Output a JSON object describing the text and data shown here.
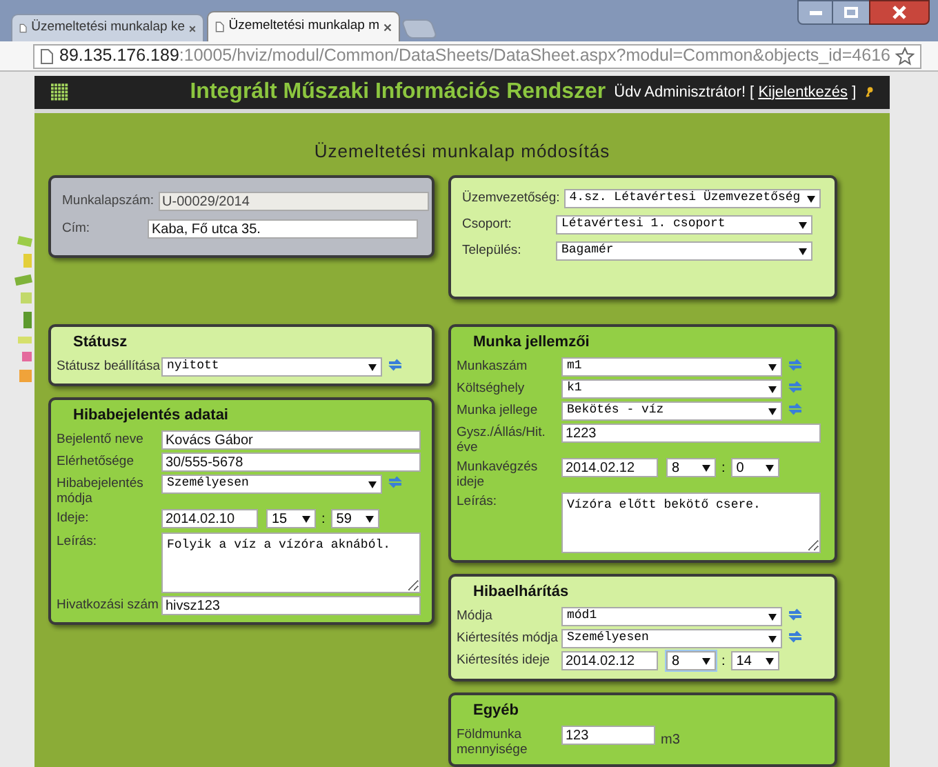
{
  "browser": {
    "tabs": [
      {
        "title": "Üzemeltetési munkalap ke",
        "selected": false
      },
      {
        "title": "Üzemeltetési munkalap m",
        "selected": true
      }
    ],
    "url_host": "89.135.176.189",
    "url_rest": ":10005/hviz/modul/Common/DataSheets/DataSheet.aspx?modul=Common&objects_id=4616"
  },
  "header": {
    "title": "Integrált Műszaki Információs Rendszer",
    "greeting_prefix": "Üdv Adminisztrátor! [",
    "logout": "Kijelentkezés",
    "greeting_suffix": "]"
  },
  "page_title": "Üzemeltetési munkalap módosítás",
  "top_panels": [
    {
      "kind": "gray",
      "rows": [
        {
          "kind": "disabled",
          "label": "Munkalapszám:",
          "value": "U-00029/2014"
        },
        {
          "kind": "text",
          "label": "Cím:",
          "value": "Kaba, Fő utca 35."
        }
      ]
    },
    {
      "kind": "light",
      "rows": [
        {
          "kind": "select",
          "label": "Üzemvezetőség:",
          "value": "4.sz. Létavértesi Üzemvezetőség",
          "refresh": false
        },
        {
          "kind": "select",
          "label": "Csoport:",
          "value": "Létavértesi 1. csoport",
          "refresh": false
        },
        {
          "kind": "select",
          "label": "Település:",
          "value": "Bagamér",
          "refresh": false
        }
      ]
    }
  ],
  "left_panels": [
    {
      "kind": "light",
      "heading": "Státusz",
      "rows": [
        {
          "kind": "select",
          "label": "Státusz beállítása",
          "value": "nyitott",
          "refresh": true
        }
      ]
    },
    {
      "kind": "bright",
      "heading": "Hibabejelentés adatai",
      "rows": [
        {
          "kind": "text",
          "label": "Bejelentő neve",
          "value": "Kovács Gábor"
        },
        {
          "kind": "text",
          "label": "Elérhetősége",
          "value": "30/555-5678"
        },
        {
          "kind": "select",
          "label": "Hibabejelentés módja",
          "value": "Személyesen",
          "refresh": true
        },
        {
          "kind": "datetime",
          "label": "Ideje:",
          "value": "2014.02.10",
          "hour": "15",
          "separator": ":",
          "minute": "59",
          "hour_focused": false
        },
        {
          "kind": "textarea",
          "label": "Leírás:",
          "value": "Folyik a víz a vízóra aknából."
        },
        {
          "kind": "text",
          "label": "Hivatkozási szám",
          "value": "hivsz123"
        }
      ]
    }
  ],
  "right_panels": [
    {
      "kind": "bright",
      "heading": "Munka jellemzői",
      "rows": [
        {
          "kind": "select",
          "label": "Munkaszám",
          "value": "m1",
          "refresh": true
        },
        {
          "kind": "select",
          "label": "Költséghely",
          "value": "k1",
          "refresh": true
        },
        {
          "kind": "select",
          "label": "Munka jellege",
          "value": "Bekötés - víz",
          "refresh": true
        },
        {
          "kind": "text",
          "label": "Gysz./Állás/Hit. éve",
          "value": "1223"
        },
        {
          "kind": "datetime",
          "label": "Munkavégzés ideje",
          "value": "2014.02.12",
          "hour": "8",
          "separator": ":",
          "minute": "0",
          "hour_focused": false
        },
        {
          "kind": "textarea",
          "label": "Leírás:",
          "value": "Vízóra előtt bekötő csere."
        }
      ]
    },
    {
      "kind": "light",
      "heading": "Hibaelhárítás",
      "rows": [
        {
          "kind": "select",
          "label": "Módja",
          "value": "mód1",
          "refresh": true
        },
        {
          "kind": "select",
          "label": "Kiértesítés módja",
          "value": "Személyesen",
          "refresh": true
        },
        {
          "kind": "datetime",
          "label": "Kiértesítés ideje",
          "value": "2014.02.12",
          "hour": "8",
          "separator": ":",
          "minute": "14",
          "hour_focused": true
        }
      ]
    },
    {
      "kind": "bright",
      "heading": "Egyéb",
      "rows": [
        {
          "kind": "unit",
          "label": "Földmunka mennyisége",
          "value": "123",
          "unit": "m3"
        }
      ]
    }
  ]
}
